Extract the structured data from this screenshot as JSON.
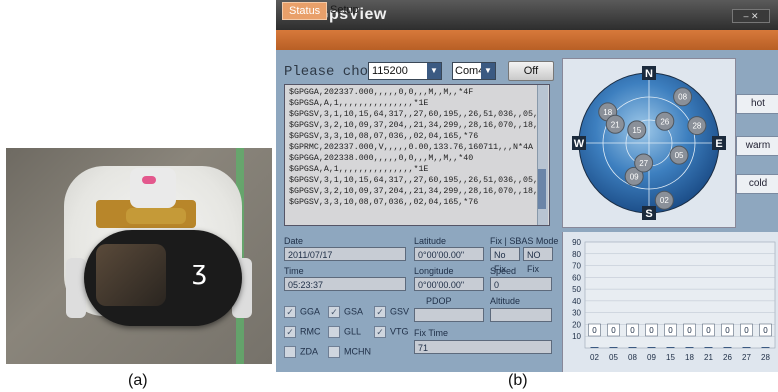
{
  "captions": {
    "a": "(a)",
    "b": "(b)"
  },
  "window": {
    "title": "GpsView",
    "menu": [
      "Status",
      "Setup"
    ],
    "prompt": "Please choose:",
    "baud": "115200",
    "com": "Com40",
    "off_button": "Off",
    "log_lines": [
      "$GPGGA,202337.000,,,,,0,0,,,M,,M,,*4F",
      "$GPGSA,A,1,,,,,,,,,,,,,,,*1E",
      "$GPGSV,3,1,10,15,64,317,,27,60,195,,26,51,036,,05,43,112,*72",
      "$GPGSV,3,2,10,09,37,204,,21,34,299,,28,16,070,,18,15,307,*77",
      "$GPGSV,3,3,10,08,07,036,,02,04,165,*76",
      "$GPRMC,202337.000,V,,,,,0.00,133.76,160711,,,N*4A",
      "$GPGGA,202338.000,,,,,0,0,,,M,,M,,*40",
      "$GPGSA,A,1,,,,,,,,,,,,,,,*1E",
      "$GPGSV,3,1,10,15,64,317,,27,60,195,,26,51,036,,05,43,112,*72",
      "$GPGSV,3,2,10,09,37,204,,21,34,299,,28,16,070,,18,15,307,*77",
      "$GPGSV,3,3,10,08,07,036,,02,04,165,*76"
    ],
    "sky": {
      "compass": {
        "n": "N",
        "s": "S",
        "e": "E",
        "w": "W"
      },
      "satellites": [
        {
          "id": "18",
          "az": 307,
          "el": 15
        },
        {
          "id": "21",
          "az": 299,
          "el": 34
        },
        {
          "id": "15",
          "az": 317,
          "el": 64
        },
        {
          "id": "05",
          "az": 112,
          "el": 43
        },
        {
          "id": "26",
          "az": 36,
          "el": 51
        },
        {
          "id": "28",
          "az": 70,
          "el": 16
        },
        {
          "id": "09",
          "az": 204,
          "el": 37
        },
        {
          "id": "27",
          "az": 195,
          "el": 60
        },
        {
          "id": "02",
          "az": 165,
          "el": 4
        },
        {
          "id": "08",
          "az": 36,
          "el": 7
        }
      ]
    },
    "side_buttons": [
      "hot",
      "warm",
      "cold"
    ],
    "status": {
      "date_label": "Date",
      "date": "2011/07/17",
      "time_label": "Time",
      "time": "05:23:37",
      "lat_label": "Latitude",
      "lat": "0°00'00.00\"",
      "lon_label": "Longitude",
      "lon": "0°00'00.00\"",
      "fix_label": "Fix | SBAS Mode",
      "fix": "No Fix",
      "sbas": "NO Fix",
      "speed_label": "Speed",
      "speed": "0",
      "pdop_label": "PDOP",
      "pdop": "",
      "alt_label": "Altitude",
      "alt": "",
      "fixtime_label": "Fix Time",
      "fixtime": "71"
    },
    "checkboxes": [
      {
        "label": "GGA",
        "checked": true
      },
      {
        "label": "GSA",
        "checked": true
      },
      {
        "label": "GSV",
        "checked": true
      },
      {
        "label": "RMC",
        "checked": true
      },
      {
        "label": "GLL",
        "checked": false
      },
      {
        "label": "VTG",
        "checked": true
      },
      {
        "label": "ZDA",
        "checked": false
      },
      {
        "label": "MCHN",
        "checked": false
      }
    ]
  },
  "chart_data": {
    "type": "bar",
    "categories": [
      "02",
      "05",
      "08",
      "09",
      "15",
      "18",
      "21",
      "26",
      "27",
      "28"
    ],
    "values": [
      0,
      0,
      0,
      0,
      0,
      0,
      0,
      0,
      0,
      0
    ],
    "ylim": [
      0,
      90
    ],
    "yticks": [
      "90",
      "80",
      "70",
      "60",
      "50",
      "40",
      "30",
      "20",
      "10"
    ]
  },
  "colors": {
    "accent": "#d7793b",
    "window": "#8ea7bf"
  }
}
